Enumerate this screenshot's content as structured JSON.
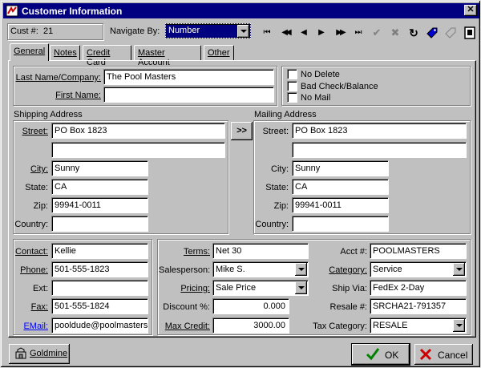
{
  "window": {
    "title": "Customer Information",
    "close_label": "✕"
  },
  "header": {
    "cust_label": "Cust #:",
    "cust_value": "21",
    "navigate_label": "Navigate By:",
    "navigate_value": "Number"
  },
  "toolbar": {
    "first": "⏮",
    "prev_page": "◀◀",
    "prev": "◀",
    "next": "▶",
    "next_page": "▶▶",
    "last": "⏭",
    "accept": "✔",
    "cancel": "✖",
    "refresh": "↻"
  },
  "tabs": [
    {
      "label": "General"
    },
    {
      "label": "Notes"
    },
    {
      "label": "Credit Card"
    },
    {
      "label": "Master Account"
    },
    {
      "label": "Other"
    }
  ],
  "general": {
    "last_name_label": "Last Name/Company:",
    "last_name_value": "The Pool Masters",
    "first_name_label": "First Name:",
    "first_name_value": "",
    "checks": [
      {
        "label": "No Delete",
        "checked": false
      },
      {
        "label": "Bad Check/Balance",
        "checked": false
      },
      {
        "label": "No Mail",
        "checked": false
      }
    ],
    "shipping": {
      "title": "Shipping Address",
      "street_label": "Street:",
      "street1": "PO Box 1823",
      "street2": "",
      "city_label": "City:",
      "city": "Sunny",
      "state_label": "State:",
      "state": "CA",
      "zip_label": "Zip:",
      "zip": "99941-0011",
      "country_label": "Country:",
      "country": ""
    },
    "copy_button": ">>",
    "mailing": {
      "title": "Mailing Address",
      "street_label": "Street:",
      "street1": "PO Box 1823",
      "street2": "",
      "city_label": "City:",
      "city": "Sunny",
      "state_label": "State:",
      "state": "CA",
      "zip_label": "Zip:",
      "zip": "99941-0011",
      "country_label": "Country:",
      "country": ""
    },
    "contact": {
      "contact_label": "Contact:",
      "contact": "Kellie",
      "phone_label": "Phone:",
      "phone": "501-555-1823",
      "ext_label": "Ext:",
      "ext": "",
      "fax_label": "Fax:",
      "fax": "501-555-1824",
      "email_label": "EMail:",
      "email": "pooldude@poolmasters."
    },
    "terms": {
      "terms_label": "Terms:",
      "terms": "Net 30",
      "salesperson_label": "Salesperson:",
      "salesperson": "Mike S.",
      "pricing_label": "Pricing:",
      "pricing": "Sale Price",
      "discount_label": "Discount %:",
      "discount": "0.000",
      "max_credit_label": "Max Credit:",
      "max_credit": "3000.00"
    },
    "account": {
      "acct_label": "Acct #:",
      "acct": "POOLMASTERS",
      "category_label": "Category:",
      "category": "Service",
      "ship_via_label": "Ship Via:",
      "ship_via": "FedEx 2-Day",
      "resale_label": "Resale #:",
      "resale": "SRCHA21-791357",
      "tax_category_label": "Tax Category:",
      "tax_category": "RESALE"
    }
  },
  "footer": {
    "goldmine_label": "Goldmine",
    "ok_label": "OK",
    "cancel_label": "Cancel"
  },
  "colors": {
    "title_bar": "#000080",
    "face": "#c0c0c0",
    "link": "#0000ff",
    "ok_check": "#008000",
    "cancel_x": "#cc0000"
  }
}
